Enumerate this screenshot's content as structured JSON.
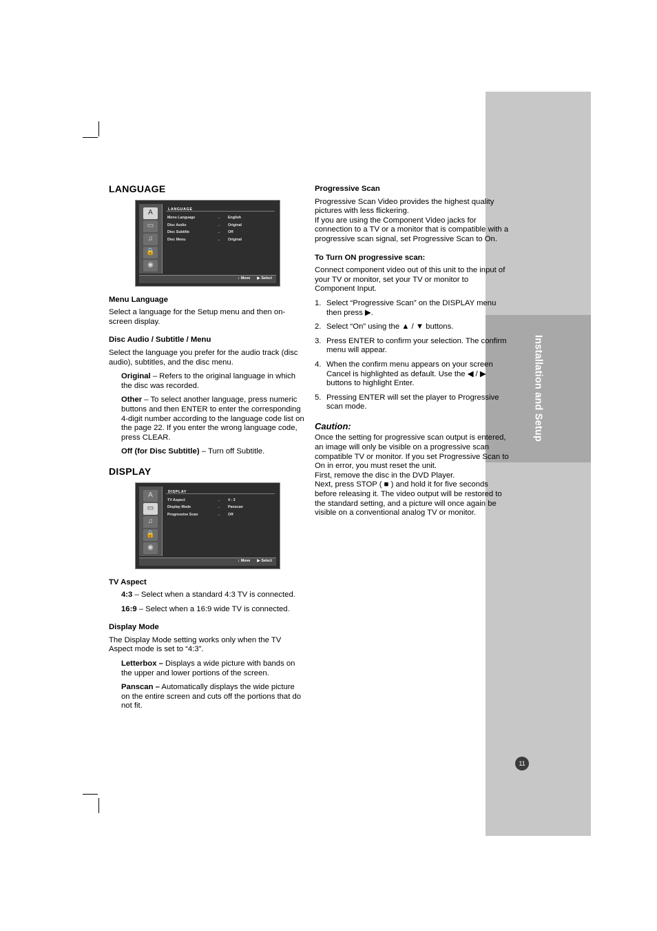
{
  "side_tab": {
    "label": "Installation and Setup"
  },
  "page_number": "11",
  "left_column": {
    "language_heading": "LANGUAGE",
    "language_osd": {
      "title": "LANGUAGE",
      "rows": [
        {
          "label": "Menu Language",
          "arrow": "→",
          "value": "English"
        },
        {
          "label": "Disc Audio",
          "arrow": "→",
          "value": "Original"
        },
        {
          "label": "Disc Subtitle",
          "arrow": "→",
          "value": "Off"
        },
        {
          "label": "Disc Menu",
          "arrow": "→",
          "value": "Original"
        }
      ],
      "footer_move": "Move",
      "footer_select": "Select",
      "icons": [
        "A",
        "speaker-icon",
        "monitor-icon",
        "lock-icon",
        "disc-icon"
      ]
    },
    "menu_language_heading": "Menu Language",
    "menu_language_body": "Select a language for the Setup menu and then on-screen display.",
    "disc_audio_heading_parts": {
      "a": "Disc Audio",
      "sep1": " / ",
      "b": "Subtitle",
      "sep2": " / ",
      "c": "Menu"
    },
    "disc_audio_body": "Select the language you prefer for the audio track (disc audio), subtitles, and the disc menu.",
    "original_term": "Original",
    "original_body": " – Refers to the original language in which the disc was recorded.",
    "other_term": "Other",
    "other_body": " – To select another language, press numeric buttons and then ENTER to enter the corresponding 4-digit number according to the language code list on the page 22. If you enter the wrong language code, press CLEAR.",
    "off_term": "Off (for Disc Subtitle)",
    "off_body": " – Turn off Subtitle.",
    "display_heading": "DISPLAY",
    "display_osd": {
      "title": "DISPLAY",
      "rows": [
        {
          "label": "TV Aspect",
          "arrow": "→",
          "value": "4 : 3"
        },
        {
          "label": "Display Mode",
          "arrow": "→",
          "value": "Panscan"
        },
        {
          "label": "Progressive Scan",
          "arrow": "→",
          "value": "Off"
        }
      ],
      "footer_move": "Move",
      "footer_select": "Select",
      "icons": [
        "A",
        "monitor-icon",
        "lock-icon",
        "speaker-icon",
        "disc-icon"
      ]
    },
    "tv_aspect_heading": "TV Aspect",
    "tv_aspect_43_term": "4:3",
    "tv_aspect_43_body": " – Select when a standard 4:3 TV is connected.",
    "tv_aspect_169_term": "16:9",
    "tv_aspect_169_body": " – Select when a 16:9 wide TV is connected.",
    "display_mode_heading": "Display Mode",
    "display_mode_body": "The Display Mode setting works only when the TV Aspect mode is set to “4:3”.",
    "letterbox_term": "Letterbox –",
    "letterbox_body": " Displays a wide picture with bands on the upper and lower portions of the screen.",
    "panscan_term": "Panscan –",
    "panscan_body": " Automatically displays the wide picture on the entire screen and cuts off the portions that do not fit."
  },
  "right_column": {
    "progressive_scan_heading": "Progressive Scan",
    "para1": "Progressive Scan Video provides the highest quality pictures with less flickering.",
    "para2": "If you are using the Component Video jacks for connection to a TV or a monitor that is compatible with a progressive scan signal, set Progressive Scan to On.",
    "turn_on_heading": "To Turn ON progressive scan:",
    "para3": "Connect component video out of this unit to the input of your TV or monitor, set your TV or monitor to Component Input.",
    "steps": [
      {
        "num": "1.",
        "text": "Select “Progressive Scan” on the DISPLAY menu then press ▶."
      },
      {
        "num": "2.",
        "text": "Select “On” using the ▲ / ▼ buttons."
      },
      {
        "num": "3.",
        "text": "Press ENTER to confirm your selection. The confirm menu will appear."
      },
      {
        "num": "4.",
        "text": "When the confirm menu appears on your screen Cancel is highlighted as default. Use the ◀ / ▶ buttons to highlight Enter."
      },
      {
        "num": "5.",
        "text": "Pressing ENTER will set the player to Progressive scan mode."
      }
    ],
    "caution_heading": "Caution:",
    "caution_para1": "Once the setting for progressive scan output is entered, an image will only be visible on a progressive scan compatible TV or monitor. If you set Progressive Scan to On in error, you must reset the unit.",
    "caution_para2": "First, remove the disc in the DVD Player.",
    "caution_para3": "Next, press STOP ( ■ ) and hold it for five seconds before releasing it. The video output will be restored to the standard setting, and a picture will once again be visible on a conventional analog TV or monitor."
  }
}
